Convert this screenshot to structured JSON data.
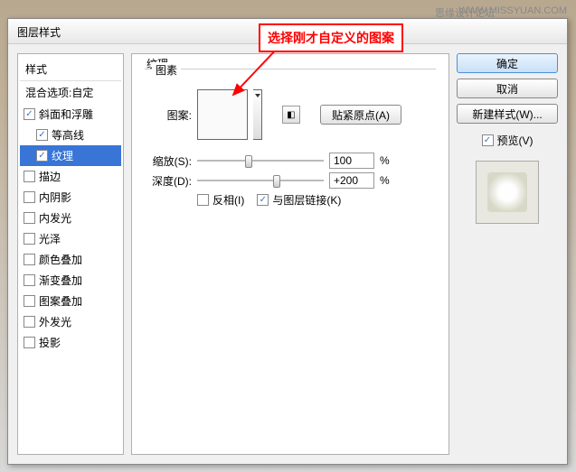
{
  "watermark": "WWW.MISSYUAN.COM",
  "watermark2": "思缘设计论坛",
  "dialog": {
    "title": "图层样式"
  },
  "left": {
    "styles_label": "样式",
    "blend_label": "混合选项:自定",
    "items": [
      {
        "label": "斜面和浮雕",
        "checked": true,
        "selected": false,
        "indent": false
      },
      {
        "label": "等高线",
        "checked": true,
        "selected": false,
        "indent": true
      },
      {
        "label": "纹理",
        "checked": true,
        "selected": true,
        "indent": true
      },
      {
        "label": "描边",
        "checked": false,
        "selected": false,
        "indent": false
      },
      {
        "label": "内阴影",
        "checked": false,
        "selected": false,
        "indent": false
      },
      {
        "label": "内发光",
        "checked": false,
        "selected": false,
        "indent": false
      },
      {
        "label": "光泽",
        "checked": false,
        "selected": false,
        "indent": false
      },
      {
        "label": "颜色叠加",
        "checked": false,
        "selected": false,
        "indent": false
      },
      {
        "label": "渐变叠加",
        "checked": false,
        "selected": false,
        "indent": false
      },
      {
        "label": "图案叠加",
        "checked": false,
        "selected": false,
        "indent": false
      },
      {
        "label": "外发光",
        "checked": false,
        "selected": false,
        "indent": false
      },
      {
        "label": "投影",
        "checked": false,
        "selected": false,
        "indent": false
      }
    ]
  },
  "mid": {
    "group_label": "纹理",
    "elements_label": "图素",
    "pattern_label": "图案:",
    "snap_btn": "贴紧原点(A)",
    "scale_label": "缩放(S):",
    "scale_value": "100",
    "depth_label": "深度(D):",
    "depth_value": "+200",
    "percent": "%",
    "invert_label": "反相(I)",
    "invert_checked": false,
    "link_label": "与图层链接(K)",
    "link_checked": true
  },
  "right": {
    "ok": "确定",
    "cancel": "取消",
    "new_style": "新建样式(W)...",
    "preview_label": "预览(V)",
    "preview_checked": true
  },
  "callout": {
    "text": "选择刚才自定义的图案"
  }
}
